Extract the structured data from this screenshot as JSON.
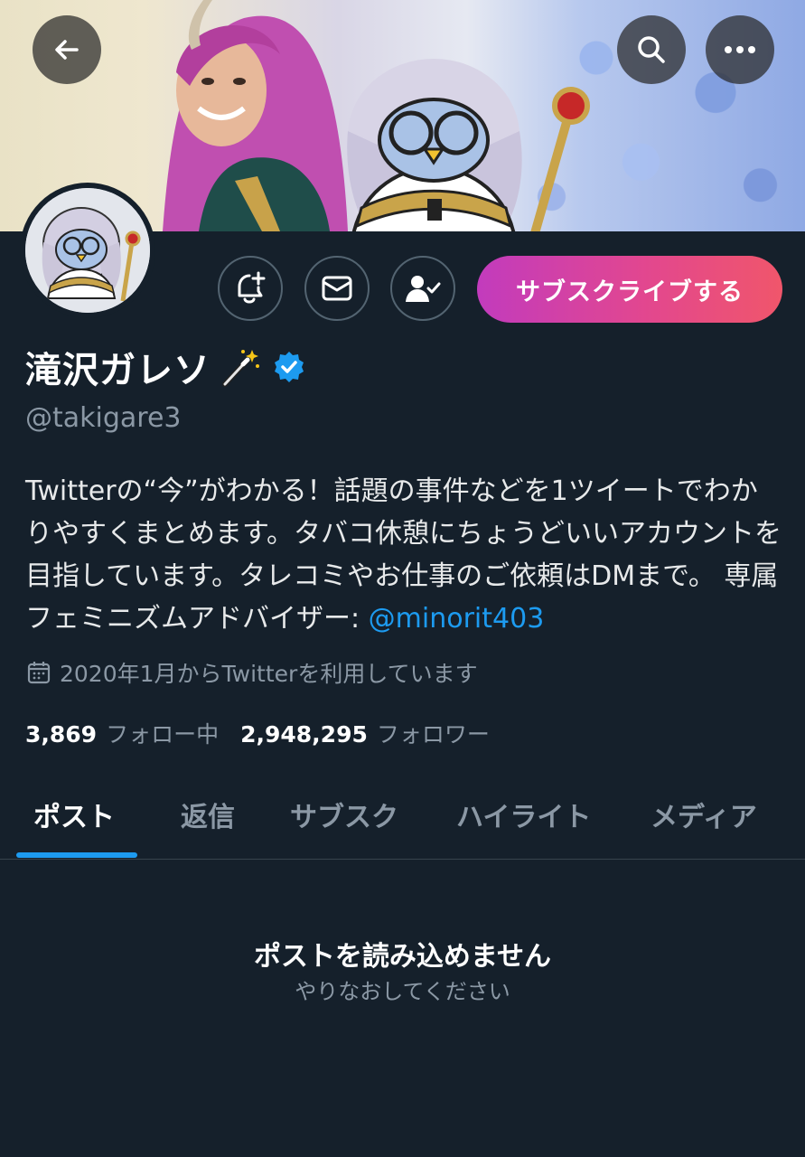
{
  "header": {
    "back_icon": "arrow-left-icon",
    "search_icon": "search-icon",
    "more_icon": "more-horizontal-icon"
  },
  "actions": {
    "notify_icon": "bell-plus-icon",
    "dm_icon": "envelope-icon",
    "following_icon": "user-check-icon",
    "subscribe_label": "サブスクライブする"
  },
  "profile": {
    "display_name": "滝沢ガレソ",
    "handle": "@takigare3",
    "bio": "Twitterの“今”がわかる！話題の事件などを1ツイートでわかりやすくまとめます。タバコ休憩にちょうどいいアカウントを目指しています。タレコミやお仕事のご依頼はDMまで。 専属フェミニズムアドバイザー: ",
    "bio_mention": "@minorit403",
    "joined": "2020年1月からTwitterを利用しています",
    "following_count": "3,869",
    "following_label": "フォロー中",
    "followers_count": "2,948,295",
    "followers_label": "フォロワー"
  },
  "tabs": [
    {
      "label": "ポスト",
      "active": true
    },
    {
      "label": "返信",
      "active": false
    },
    {
      "label": "サブスク",
      "active": false
    },
    {
      "label": "ハイライト",
      "active": false
    },
    {
      "label": "メディア",
      "active": false
    }
  ],
  "empty_state": {
    "title": "ポストを読み込めません",
    "subtitle": "やりなおしてください"
  },
  "colors": {
    "background": "#15202b",
    "accent": "#1d9bf0",
    "subscribe_gradient_start": "#c23bbd",
    "subscribe_gradient_end": "#f0566b"
  }
}
